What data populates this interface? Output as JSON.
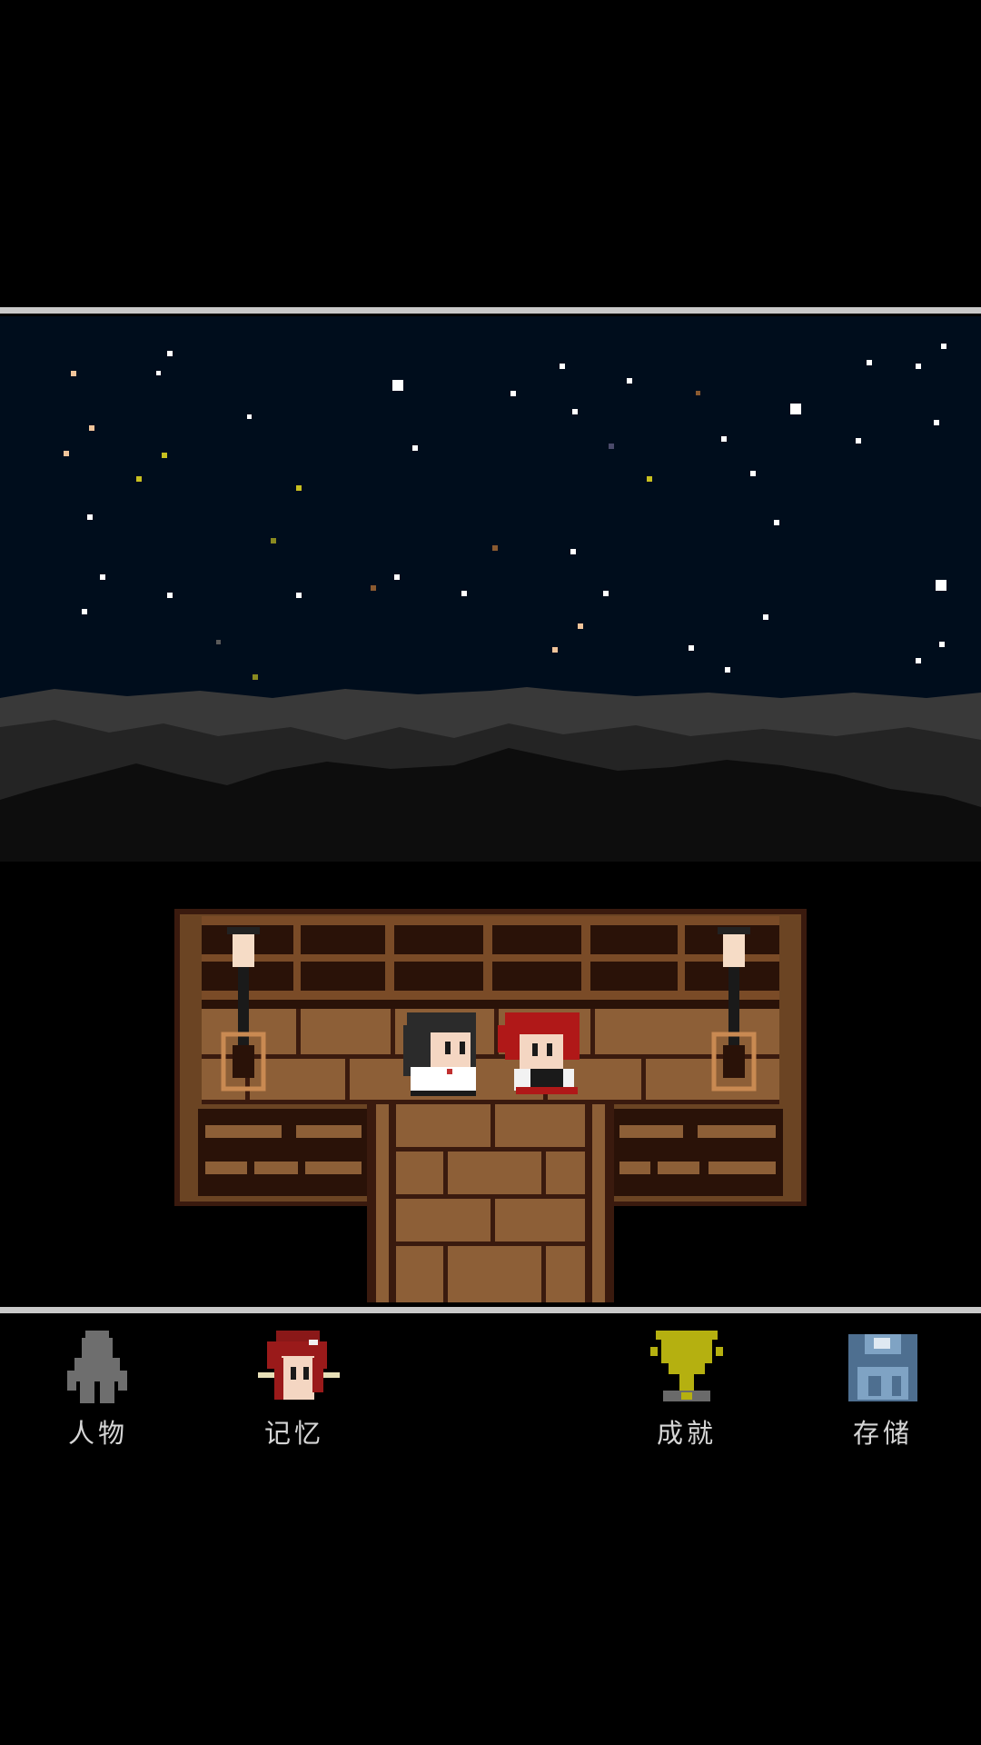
{
  "menu": {
    "characters": {
      "label": "人物",
      "icon": "person-silhouette-icon"
    },
    "memories": {
      "label": "记忆",
      "icon": "red-haired-portrait-icon"
    },
    "achievements": {
      "label": "成就",
      "icon": "trophy-icon"
    },
    "save": {
      "label": "存储",
      "icon": "floppy-disk-icon"
    }
  },
  "colors": {
    "sky": "#000d1c",
    "hills": "#2b2b2b",
    "wood": "#6b4423",
    "dark_wood": "#3a1a0e",
    "divider": "#c9c9c9",
    "label": "#d6d6d6"
  }
}
